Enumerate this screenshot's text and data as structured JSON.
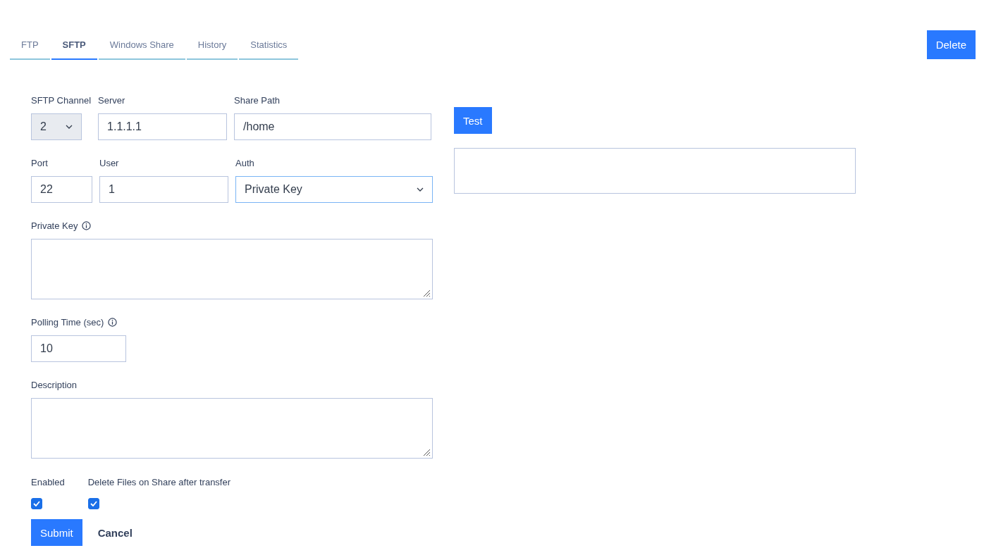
{
  "tabs": [
    {
      "label": "FTP",
      "selected": false
    },
    {
      "label": "SFTP",
      "selected": true
    },
    {
      "label": "Windows Share",
      "selected": false
    },
    {
      "label": "History",
      "selected": false
    },
    {
      "label": "Statistics",
      "selected": false
    }
  ],
  "delete_button": "Delete",
  "rows": [
    [
      {
        "kind": "select",
        "label": "SFTP Channel",
        "value": "2",
        "disabled": true,
        "focused": false
      },
      {
        "kind": "input",
        "label": "Server",
        "value": "1.1.1.1",
        "disabled": false,
        "focused": false
      },
      {
        "kind": "input",
        "label": "Share Path",
        "value": "/home",
        "disabled": false,
        "focused": false
      }
    ],
    [
      {
        "kind": "input",
        "label": "Port",
        "value": "22",
        "disabled": false,
        "focused": false
      },
      {
        "kind": "input",
        "label": "User",
        "value": "1",
        "disabled": false,
        "focused": false
      },
      {
        "kind": "select",
        "label": "Auth",
        "value": "Private Key",
        "disabled": false,
        "focused": true
      }
    ]
  ],
  "blocks": [
    {
      "kind": "textarea",
      "label": "Private Key",
      "hint": true
    },
    {
      "kind": "input",
      "label": "Polling Time (sec)",
      "hint": true,
      "value": "10"
    },
    {
      "kind": "textarea",
      "label": "Description",
      "hint": false
    }
  ],
  "checkboxes": [
    {
      "label": "Enabled",
      "checked": true
    },
    {
      "label": "Delete Files on Share after transfer",
      "checked": true
    }
  ],
  "submit_button": "Submit",
  "cancel_button": "Cancel",
  "test_button": "Test"
}
